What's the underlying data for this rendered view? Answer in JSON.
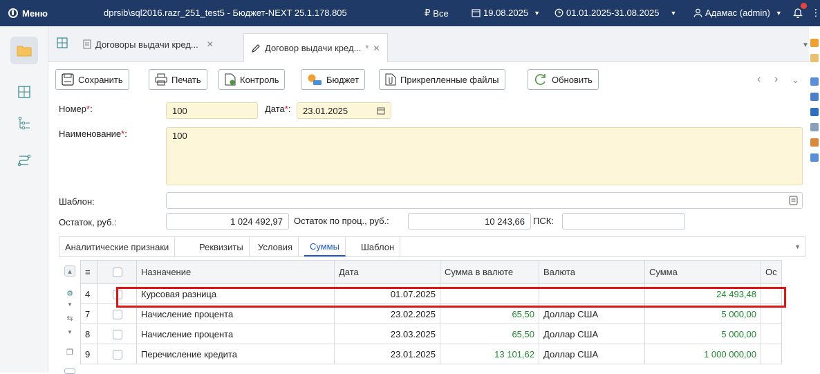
{
  "titlebar": {
    "menu_label": "Меню",
    "window_title": "dprsib\\sql2016.razr_251_test5 - Бюджет-NEXT 25.1.178.805",
    "currency_filter": "Все",
    "current_date": "19.08.2025",
    "period": "01.01.2025-31.08.2025",
    "user": "Адамас (admin)"
  },
  "tabs": [
    {
      "label": "Договоры выдачи кред...",
      "modified": ""
    },
    {
      "label": "Договор выдачи кред...",
      "modified": "*"
    }
  ],
  "toolbar": {
    "save_label": "Сохранить",
    "print_label": "Печать",
    "control_label": "Контроль",
    "budget_label": "Бюджет",
    "files_label": "Прикрепленные файлы",
    "refresh_label": "Обновить"
  },
  "form": {
    "number_label": "Номер",
    "number_value": "100",
    "date_label": "Дата",
    "date_value": "23.01.2025",
    "name_label": "Наименование",
    "name_value": "100",
    "template_label": "Шаблон:",
    "template_value": "",
    "balance_label": "Остаток, руб.:",
    "balance_value": "1 024 492,97",
    "interest_balance_label": "Остаток по проц., руб.:",
    "interest_balance_value": "10 243,66",
    "psk_label": "ПСК:",
    "psk_value": ""
  },
  "subtabs": [
    "Аналитические признаки",
    "Реквизиты",
    "Условия",
    "Суммы",
    "Шаблон"
  ],
  "active_subtab": "Суммы",
  "grid": {
    "columns": [
      "Назначение",
      "Дата",
      "Сумма в валюте",
      "Валюта",
      "Сумма",
      "Ос"
    ],
    "rows": [
      {
        "num": "4",
        "purpose": "Курсовая разница",
        "date": "01.07.2025",
        "amount_currency": "",
        "currency": "",
        "amount": "24 493,48"
      },
      {
        "num": "7",
        "purpose": "Начисление процента",
        "date": "23.02.2025",
        "amount_currency": "65,50",
        "currency": "Доллар США",
        "amount": "5 000,00"
      },
      {
        "num": "8",
        "purpose": "Начисление процента",
        "date": "23.03.2025",
        "amount_currency": "65,50",
        "currency": "Доллар США",
        "amount": "5 000,00"
      },
      {
        "num": "9",
        "purpose": "Перечисление кредита",
        "date": "23.01.2025",
        "amount_currency": "13 101,62",
        "currency": "Доллар США",
        "amount": "1 000 000,00"
      }
    ]
  },
  "colors": {
    "accent": "#1d5bbf",
    "titlebar": "#1f3a67",
    "positive": "#1e8a2e",
    "highlight": "#e11414"
  }
}
